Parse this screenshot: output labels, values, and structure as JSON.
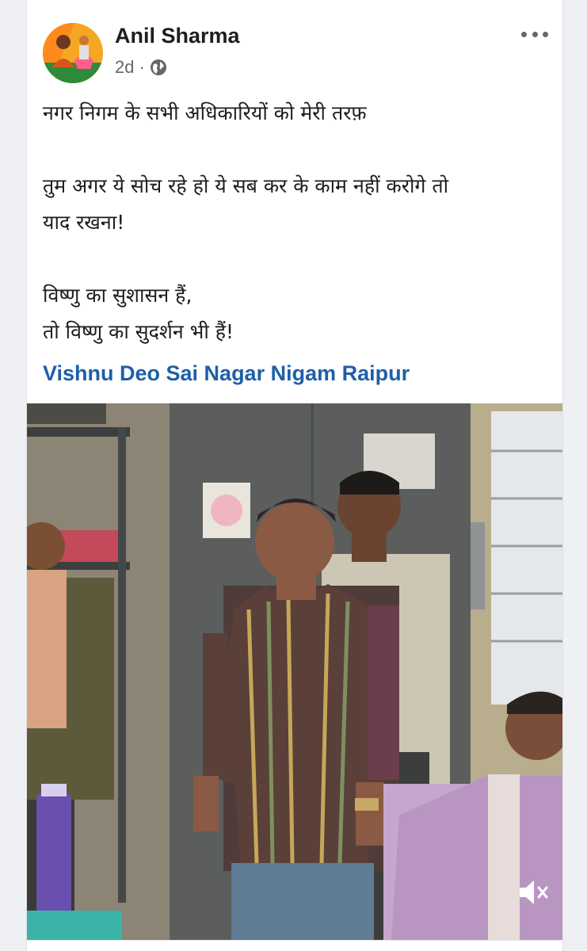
{
  "post": {
    "author": "Anil Sharma",
    "time": "2d",
    "separator": "·",
    "audience_icon": "globe-icon",
    "more_icon": "ellipsis-icon",
    "lines": [
      "नगर निगम के सभी अधिकारियों को मेरी तरफ़",
      "",
      "तुम अगर ये सोच रहे हो ये सब कर के काम नहीं करोगे तो",
      "याद रखना!",
      "",
      "विष्णु का सुशासन हैं,",
      "तो विष्णु का सुदर्शन भी हैं!"
    ],
    "tag": "Vishnu Deo Sai Nagar Nigam Raipur"
  },
  "video": {
    "mute_icon": "speaker-muted-icon"
  },
  "colors": {
    "link": "#1f5fa8",
    "meta": "#65676b",
    "avatar_bg": "#f7b035"
  }
}
